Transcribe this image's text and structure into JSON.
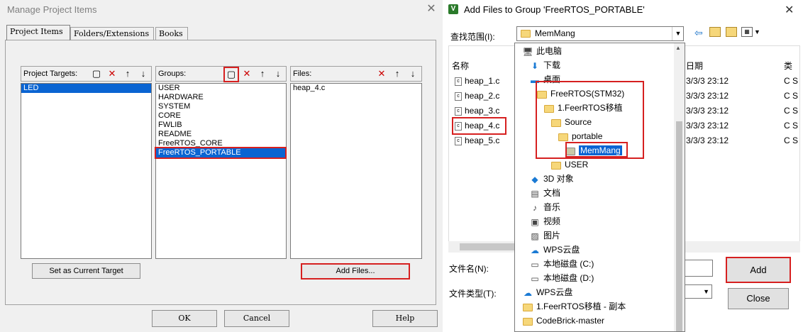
{
  "left_dialog": {
    "title": "Manage Project Items",
    "close_symbol": "✕",
    "tabs": [
      "Project Items",
      "Folders/Extensions",
      "Books"
    ],
    "project_targets": {
      "label": "Project Targets:",
      "items": [
        "LED"
      ],
      "selected": "LED"
    },
    "groups": {
      "label": "Groups:",
      "items": [
        "USER",
        "HARDWARE",
        "SYSTEM",
        "CORE",
        "FWLIB",
        "README",
        "FreeRTOS_CORE",
        "FreeRTOS_PORTABLE"
      ],
      "selected": "FreeRTOS_PORTABLE"
    },
    "files": {
      "label": "Files:",
      "items": [
        "heap_4.c"
      ]
    },
    "set_target_button": "Set as Current Target",
    "add_files_button": "Add Files...",
    "ok_button": "OK",
    "cancel_button": "Cancel",
    "help_button": "Help",
    "toolbar_icons": {
      "new": "▢",
      "delete": "✕",
      "up": "↑",
      "down": "↓"
    }
  },
  "right_dialog": {
    "title": "Add Files to Group 'FreeRTOS_PORTABLE'",
    "app_icon_letter": "V",
    "close_symbol": "✕",
    "look_in_label": "查找范围(I):",
    "look_in_value": "MemMang",
    "column_name": "名称",
    "column_date": "日期",
    "column_type": "类",
    "files": [
      {
        "name": "heap_1.c",
        "date": "3/3/3 23:12",
        "type": "C S"
      },
      {
        "name": "heap_2.c",
        "date": "3/3/3 23:12",
        "type": "C S"
      },
      {
        "name": "heap_3.c",
        "date": "3/3/3 23:12",
        "type": "C S"
      },
      {
        "name": "heap_4.c",
        "date": "3/3/3 23:12",
        "type": "C S"
      },
      {
        "name": "heap_5.c",
        "date": "3/3/3 23:12",
        "type": "C S"
      }
    ],
    "filename_label": "文件名(N):",
    "filetype_label": "文件类型(T):",
    "add_button": "Add",
    "close_button": "Close",
    "tree": [
      {
        "label": "此电脑",
        "icon": "computer-icon",
        "indent": 0
      },
      {
        "label": "下载",
        "icon": "download-icon",
        "indent": 1
      },
      {
        "label": "桌面",
        "icon": "desktop-icon",
        "indent": 1
      },
      {
        "label": "FreeRTOS(STM32)",
        "icon": "folder-icon",
        "indent": 2
      },
      {
        "label": "1.FeerRTOS移植",
        "icon": "folder-icon",
        "indent": 3
      },
      {
        "label": "Source",
        "icon": "folder-icon",
        "indent": 4
      },
      {
        "label": "portable",
        "icon": "folder-icon",
        "indent": 5
      },
      {
        "label": "MemMang",
        "icon": "folder-open-icon",
        "indent": 6
      },
      {
        "label": "USER",
        "icon": "folder-icon",
        "indent": 4
      },
      {
        "label": "3D 对象",
        "icon": "3d-objects-icon",
        "indent": 1
      },
      {
        "label": "文档",
        "icon": "documents-icon",
        "indent": 1
      },
      {
        "label": "音乐",
        "icon": "music-icon",
        "indent": 1
      },
      {
        "label": "视频",
        "icon": "video-icon",
        "indent": 1
      },
      {
        "label": "图片",
        "icon": "pictures-icon",
        "indent": 1
      },
      {
        "label": "WPS云盘",
        "icon": "cloud-icon",
        "indent": 1
      },
      {
        "label": "本地磁盘 (C:)",
        "icon": "drive-icon",
        "indent": 1
      },
      {
        "label": "本地磁盘 (D:)",
        "icon": "drive-icon",
        "indent": 1
      },
      {
        "label": "WPS云盘",
        "icon": "cloud-icon",
        "indent": 0
      },
      {
        "label": "1.FeerRTOS移植 - 副本",
        "icon": "folder-icon",
        "indent": 0
      },
      {
        "label": "CodeBrick-master",
        "icon": "folder-icon",
        "indent": 0
      }
    ]
  }
}
